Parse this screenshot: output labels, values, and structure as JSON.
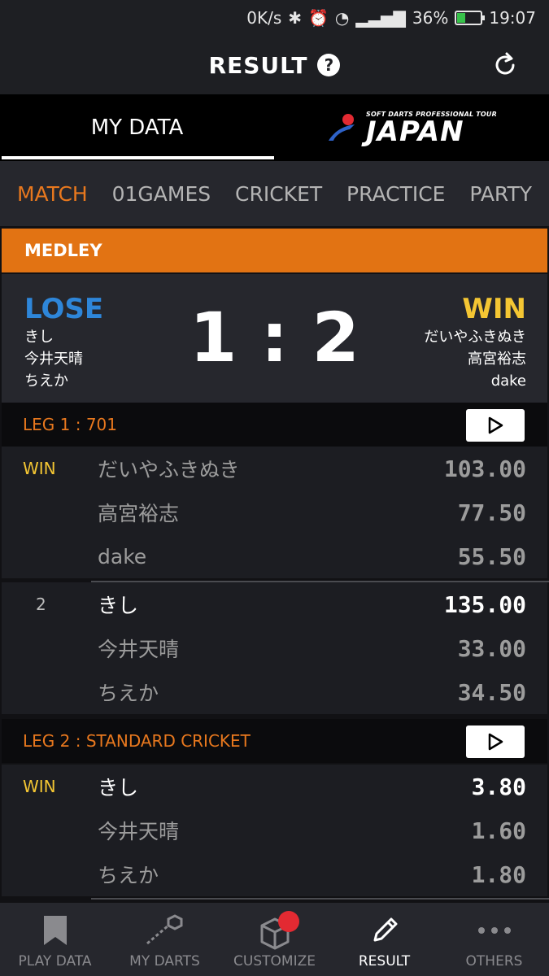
{
  "status_bar": {
    "net_speed": "0K/s",
    "battery": "36%",
    "battery_fill": 0.36,
    "time": "19:07"
  },
  "header": {
    "title": "RESULT",
    "help": "?"
  },
  "top_tabs": [
    {
      "label": "MY DATA",
      "active": true
    },
    {
      "logo_small": "SOFT DARTS PROFESSIONAL TOUR",
      "logo_big": "JAPAN"
    }
  ],
  "categories": [
    "MATCH",
    "01GAMES",
    "CRICKET",
    "PRACTICE",
    "PARTY"
  ],
  "active_category": "MATCH",
  "match": {
    "type": "MEDLEY",
    "score": "1 : 2",
    "left": {
      "result": "LOSE",
      "players": [
        "きし",
        "今井天晴",
        "ちえか"
      ]
    },
    "right": {
      "result": "WIN",
      "players": [
        "だいやふきぬき",
        "高宮裕志",
        "dake"
      ]
    }
  },
  "legs": [
    {
      "title": "LEG 1 : 701",
      "teams": [
        {
          "rank": "WIN",
          "players": [
            {
              "name": "だいやふきぬき",
              "score": "103.00"
            },
            {
              "name": "高宮裕志",
              "score": "77.50"
            },
            {
              "name": "dake",
              "score": "55.50"
            }
          ]
        },
        {
          "rank": "2",
          "players": [
            {
              "name": "きし",
              "score": "135.00"
            },
            {
              "name": "今井天晴",
              "score": "33.00"
            },
            {
              "name": "ちえか",
              "score": "34.50"
            }
          ]
        }
      ]
    },
    {
      "title": "LEG 2 : STANDARD CRICKET",
      "teams": [
        {
          "rank": "WIN",
          "players": [
            {
              "name": "きし",
              "score": "3.80"
            },
            {
              "name": "今井天晴",
              "score": "1.60"
            },
            {
              "name": "ちえか",
              "score": "1.80"
            }
          ]
        }
      ]
    }
  ],
  "bottom_nav": [
    {
      "label": "PLAY DATA",
      "icon": "bookmark-icon"
    },
    {
      "label": "MY DARTS",
      "icon": "dart-icon"
    },
    {
      "label": "CUSTOMIZE",
      "icon": "box-icon"
    },
    {
      "label": "RESULT",
      "icon": "pencil-icon",
      "active": true
    },
    {
      "label": "OTHERS",
      "icon": "more-icon"
    }
  ]
}
